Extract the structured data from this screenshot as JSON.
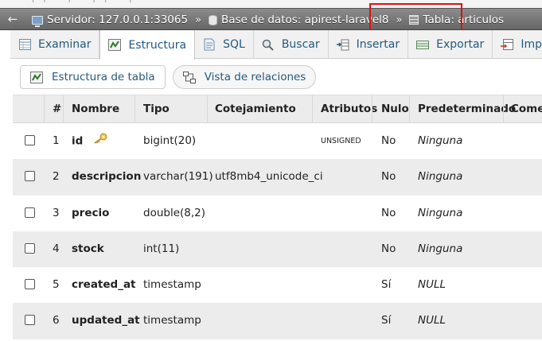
{
  "breadcrumb": {
    "server": "Servidor: 127.0.0.1:33065",
    "database": "Base de datos: apirest-laravel8",
    "table": "Tabla: articulos",
    "separator": "»"
  },
  "tabs": [
    {
      "label": "Examinar",
      "icon": "browse-icon"
    },
    {
      "label": "Estructura",
      "icon": "structure-icon",
      "active": true
    },
    {
      "label": "SQL",
      "icon": "sql-icon"
    },
    {
      "label": "Buscar",
      "icon": "search-icon"
    },
    {
      "label": "Insertar",
      "icon": "insert-icon"
    },
    {
      "label": "Exportar",
      "icon": "export-icon"
    },
    {
      "label": "Importa",
      "icon": "import-icon"
    }
  ],
  "subtabs": [
    {
      "label": "Estructura de tabla",
      "icon": "table-structure-icon"
    },
    {
      "label": "Vista de relaciones",
      "icon": "relations-icon"
    }
  ],
  "columns": [
    "#",
    "Nombre",
    "Tipo",
    "Cotejamiento",
    "Atributos",
    "Nulo",
    "Predeterminado",
    "Comen"
  ],
  "rows": [
    {
      "num": "1",
      "name": "id",
      "type": "bigint(20)",
      "collation": "",
      "attributes": "UNSIGNED",
      "null": "No",
      "default": "Ninguna",
      "primary": true
    },
    {
      "num": "2",
      "name": "descripcion",
      "type": "varchar(191)",
      "collation": "utf8mb4_unicode_ci",
      "attributes": "",
      "null": "No",
      "default": "Ninguna"
    },
    {
      "num": "3",
      "name": "precio",
      "type": "double(8,2)",
      "collation": "",
      "attributes": "",
      "null": "No",
      "default": "Ninguna"
    },
    {
      "num": "4",
      "name": "stock",
      "type": "int(11)",
      "collation": "",
      "attributes": "",
      "null": "No",
      "default": "Ninguna"
    },
    {
      "num": "5",
      "name": "created_at",
      "type": "timestamp",
      "collation": "",
      "attributes": "",
      "null": "Sí",
      "default": "NULL"
    },
    {
      "num": "6",
      "name": "updated_at",
      "type": "timestamp",
      "collation": "",
      "attributes": "",
      "null": "Sí",
      "default": "NULL"
    }
  ],
  "colors": {
    "link": "#235a81",
    "highlight": "#e01010",
    "key": "#e6b43c"
  }
}
